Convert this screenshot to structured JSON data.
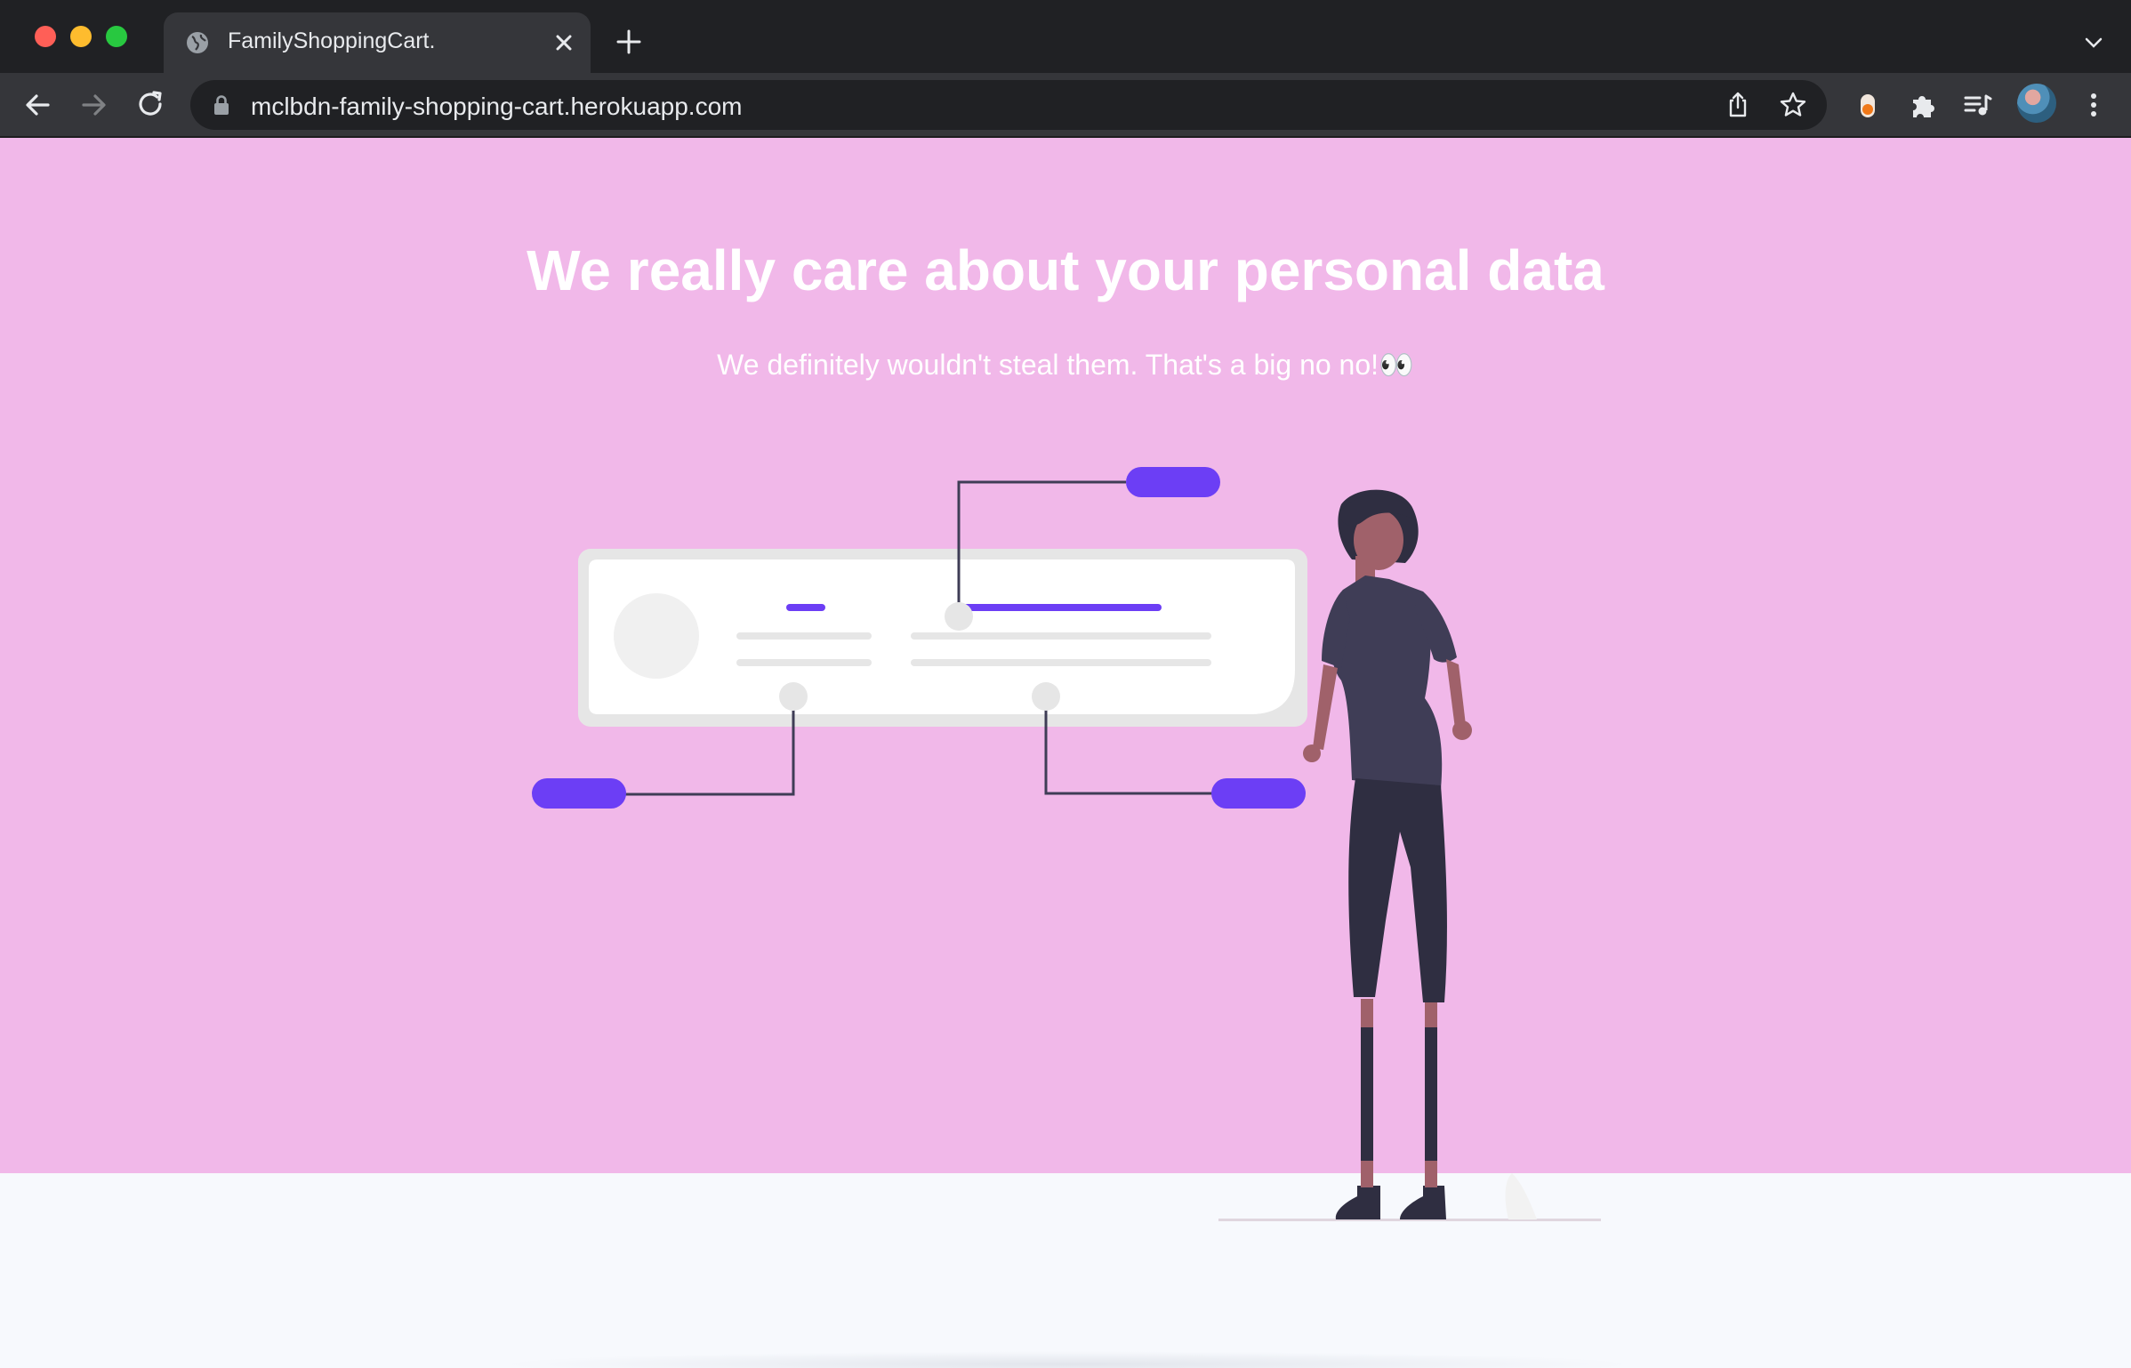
{
  "browser": {
    "tab": {
      "title": "FamilyShoppingCart.",
      "favicon": "globe-icon"
    },
    "address_bar": {
      "url": "mclbdn-family-shopping-cart.herokuapp.com"
    },
    "toolbar_icons": [
      "back-icon",
      "forward-icon",
      "reload-icon",
      "lock-icon",
      "share-icon",
      "star-icon",
      "extension-toggle-icon",
      "puzzle-icon",
      "media-queue-icon",
      "avatar",
      "menu-dots-icon"
    ]
  },
  "page": {
    "hero": {
      "title": "We really care about your personal data",
      "subtitle": "We definitely wouldn't steal them. That's a big no no!👀"
    },
    "colors": {
      "hero_background": "#f1b8e9",
      "accent": "#6c3ef5",
      "figure_dark": "#3f3d56",
      "skin": "#a0616a",
      "page_background": "#f7f9fd"
    }
  }
}
